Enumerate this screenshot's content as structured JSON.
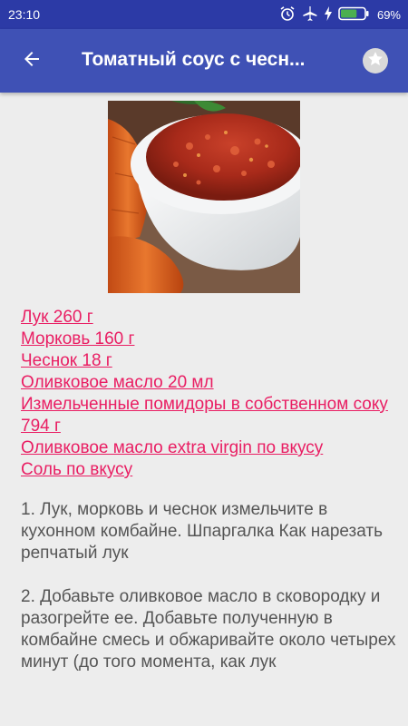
{
  "status_bar": {
    "time": "23:10",
    "battery_percent": "69%",
    "battery_level": 0.69,
    "icons": [
      "alarm-icon",
      "airplane-mode-icon",
      "charging-icon",
      "battery-icon"
    ]
  },
  "app_bar": {
    "title": "Томатный соус с чесн...",
    "back_icon": "arrow-back-icon",
    "favorite_icon": "star-icon"
  },
  "recipe": {
    "image_description_icon": "recipe-photo",
    "ingredients": [
      "Лук 260 г",
      "Морковь 160 г",
      "Чеснок 18 г",
      "Оливковое масло 20 мл",
      "Измельченные помидоры в собственном соку 794 г",
      "Оливковое масло extra virgin по вкусу",
      "Соль по вкусу"
    ],
    "steps": [
      "1. Лук, морковь и чеснок измельчите в кухонном комбайне. Шпаргалка Как нарезать репчатый лук",
      "2. Добавьте оливковое масло в сковородку и разогрейте ее. Добавьте полученную в комбайне смесь и обжаривайте около четырех минут (до того момента, как лук"
    ]
  },
  "colors": {
    "status_bar": "#2c3aa6",
    "app_bar": "#3f51b5",
    "link": "#e91e63",
    "body_text": "#555555",
    "background": "#ededed"
  }
}
